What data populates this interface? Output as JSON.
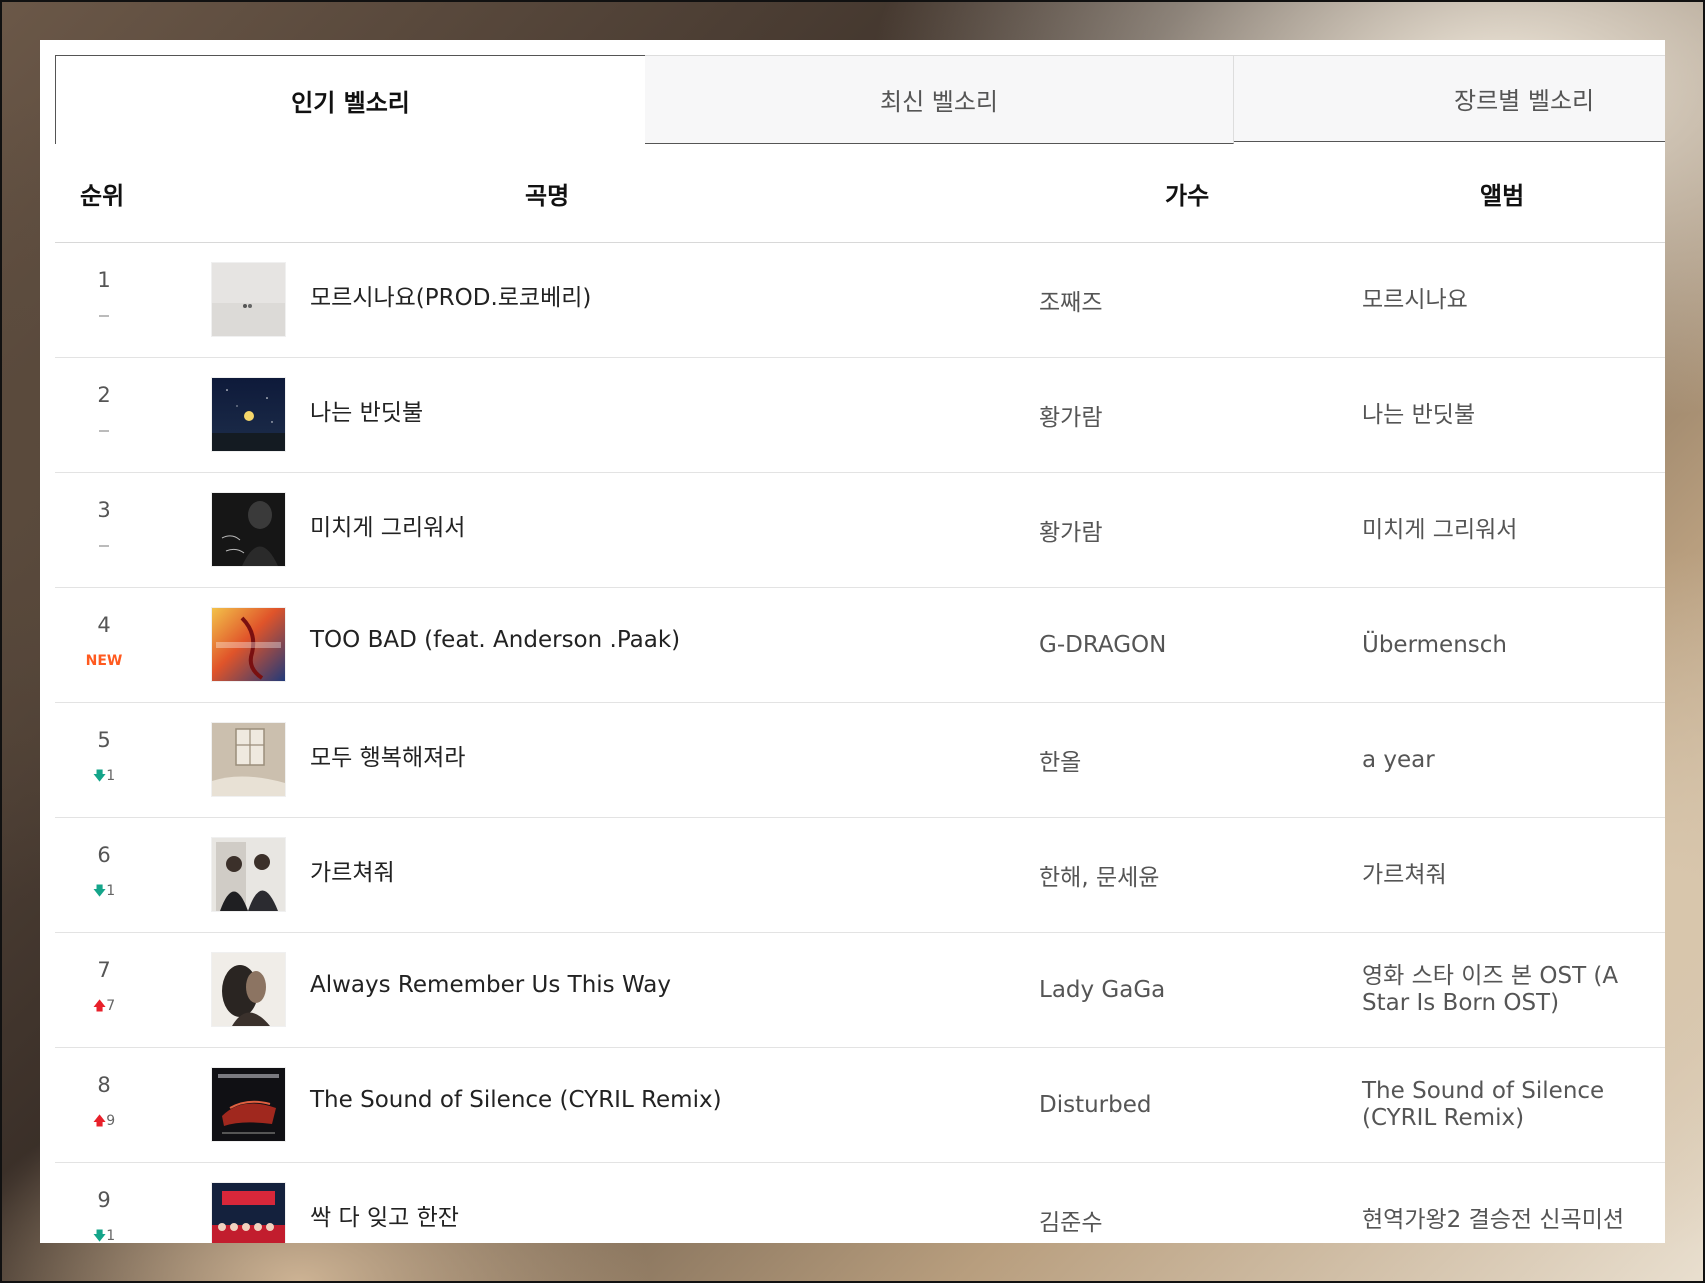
{
  "tabs": [
    {
      "label": "인기 벨소리",
      "active": true
    },
    {
      "label": "최신 벨소리",
      "active": false
    },
    {
      "label": "장르별 벨소리",
      "active": false
    }
  ],
  "table": {
    "headers": {
      "rank": "순위",
      "song": "곡명",
      "artist": "가수",
      "album": "앨범"
    },
    "rows": [
      {
        "rank": "1",
        "change": {
          "type": "same",
          "value": ""
        },
        "song": "모르시나요(PROD.로코베리)",
        "artist": "조째즈",
        "album": "모르시나요",
        "cover_icon": "cover-misty-landscape"
      },
      {
        "rank": "2",
        "change": {
          "type": "same",
          "value": ""
        },
        "song": "나는 반딧불",
        "artist": "황가람",
        "album": "나는 반딧불",
        "cover_icon": "cover-night-sky-firefly"
      },
      {
        "rank": "3",
        "change": {
          "type": "same",
          "value": ""
        },
        "song": "미치게 그리워서",
        "artist": "황가람",
        "album": "미치게 그리워서",
        "cover_icon": "cover-portrait-dark"
      },
      {
        "rank": "4",
        "change": {
          "type": "new",
          "value": "NEW"
        },
        "song": "TOO BAD (feat. Anderson .Paak)",
        "artist": "G-DRAGON",
        "album": "Übermensch",
        "cover_icon": "cover-ubermensch"
      },
      {
        "rank": "5",
        "change": {
          "type": "down",
          "value": "1"
        },
        "song": "모두 행복해져라",
        "artist": "한올",
        "album": "a year",
        "cover_icon": "cover-window-room"
      },
      {
        "rank": "6",
        "change": {
          "type": "down",
          "value": "1"
        },
        "song": "가르쳐줘",
        "artist": "한해, 문세윤",
        "album": "가르쳐줘",
        "cover_icon": "cover-two-men"
      },
      {
        "rank": "7",
        "change": {
          "type": "up",
          "value": "7"
        },
        "song": "Always Remember Us This Way",
        "artist": "Lady GaGa",
        "album": "영화 스타 이즈 본 OST (A Star Is Born OST)",
        "cover_icon": "cover-star-is-born"
      },
      {
        "rank": "8",
        "change": {
          "type": "up",
          "value": "9"
        },
        "song": "The Sound of Silence (CYRIL Remix)",
        "artist": "Disturbed",
        "album": "The Sound of Silence (CYRIL Remix)",
        "cover_icon": "cover-disturbed"
      },
      {
        "rank": "9",
        "change": {
          "type": "down",
          "value": "1"
        },
        "song": "싹 다 잊고 한잔",
        "artist": "김준수",
        "album": "현역가왕2 결승전 신곡미션",
        "cover_icon": "cover-hyunyeok-gawang"
      }
    ]
  },
  "colors": {
    "new": "#ff5a1f",
    "up": "#e8202a",
    "down": "#14a58a"
  }
}
